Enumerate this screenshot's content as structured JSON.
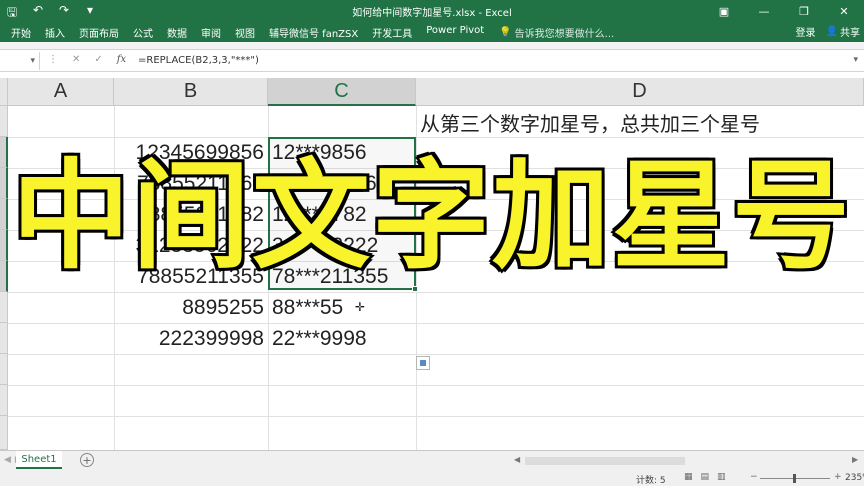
{
  "window": {
    "title": "如何给中间数字加星号.xlsx - Excel",
    "qat_icons": [
      "save-icon",
      "undo-icon",
      "redo-icon",
      "customize-icon"
    ]
  },
  "ribbon": {
    "tabs": [
      "开始",
      "插入",
      "页面布局",
      "公式",
      "数据",
      "审阅",
      "视图",
      "辅导微信号 fanZSX",
      "开发工具",
      "Power Pivot"
    ],
    "tell_me": "告诉我您想要做什么...",
    "signin": "登录",
    "share": "共享"
  },
  "formula_bar": {
    "fx": "fx",
    "formula": "=REPLACE(B2,3,3,\"***\")"
  },
  "sheet": {
    "columns": [
      "A",
      "B",
      "C",
      "D"
    ],
    "note": "从第三个数字加星号，总共加三个星号",
    "rows": [
      {
        "b": "12345699856",
        "c": "12***9856"
      },
      {
        "b": "78855211365",
        "c": "78***211365"
      },
      {
        "b": "78855211782",
        "c": "12***4782"
      },
      {
        "b": "31233562222",
        "c": "31***62222"
      },
      {
        "b": "78855211355",
        "c": "78***211355"
      },
      {
        "b": "8895255",
        "c": "88***55"
      },
      {
        "b": "222399998",
        "c": "22***9998"
      }
    ]
  },
  "overlay": {
    "caption": "中间文字加星号",
    "color": "#f8f32b"
  },
  "sheet_tabs": {
    "tabs": [
      "Sheet1"
    ],
    "add": "⊕"
  },
  "status": {
    "count": "计数: 5",
    "zoom": "235%"
  },
  "colors": {
    "excel_green": "#217346"
  }
}
